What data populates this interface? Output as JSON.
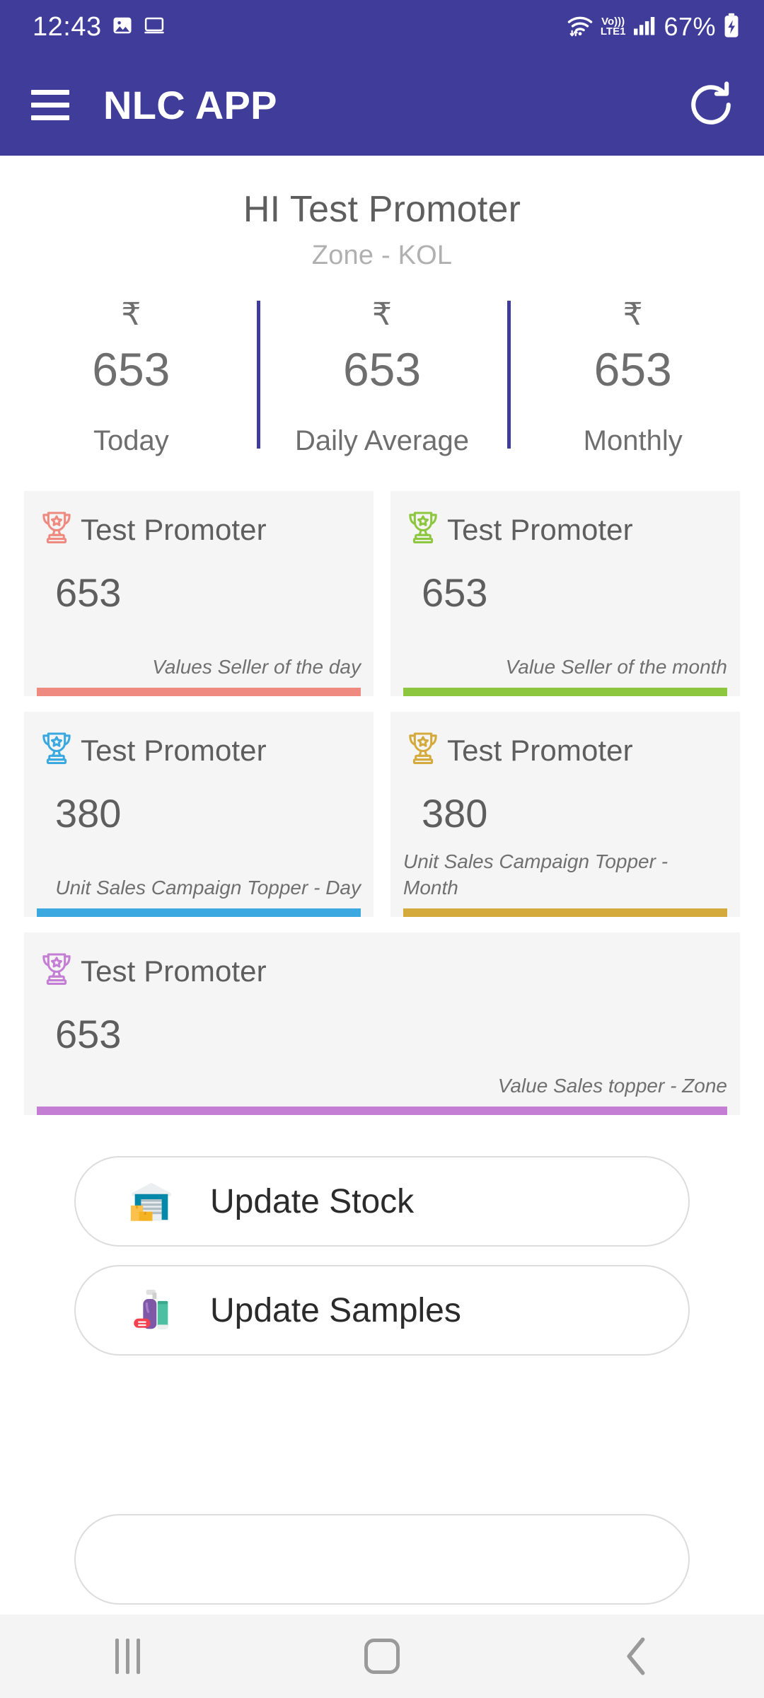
{
  "status_bar": {
    "clock": "12:43",
    "battery_percent": "67%",
    "network_label_top": "Vo)))",
    "network_label_bottom": "LTE1",
    "icons": [
      "photo-icon",
      "screen-mirror-icon",
      "wifi-icon",
      "volte-icon",
      "signal-icon",
      "battery-charging-icon"
    ]
  },
  "app_bar": {
    "title": "NLC APP",
    "menu_icon": "hamburger-menu-icon",
    "refresh_icon": "refresh-icon"
  },
  "header": {
    "greeting": "HI Test Promoter",
    "zone": "Zone - KOL"
  },
  "stats": [
    {
      "currency": "₹",
      "value": "653",
      "label": "Today"
    },
    {
      "currency": "₹",
      "value": "653",
      "label": "Daily Average"
    },
    {
      "currency": "₹",
      "value": "653",
      "label": "Monthly"
    }
  ],
  "awards": [
    {
      "name": "Test Promoter",
      "value": "653",
      "caption": "Values Seller of the day",
      "color": "#ef8a80",
      "icon": "trophy-icon",
      "layout": "half"
    },
    {
      "name": "Test Promoter",
      "value": "653",
      "caption": "Value Seller of the month",
      "color": "#8dc63f",
      "icon": "trophy-icon",
      "layout": "half"
    },
    {
      "name": "Test Promoter",
      "value": "380",
      "caption": "Unit Sales Campaign Topper - Day",
      "color": "#3ba9e0",
      "icon": "trophy-icon",
      "layout": "half"
    },
    {
      "name": "Test Promoter",
      "value": "380",
      "caption": "Unit Sales Campaign Topper - Month",
      "color": "#d4aa3c",
      "icon": "trophy-icon",
      "layout": "half"
    },
    {
      "name": "Test Promoter",
      "value": "653",
      "caption": "Value Sales topper - Zone",
      "color": "#c47fd4",
      "icon": "trophy-icon",
      "layout": "full"
    }
  ],
  "actions": [
    {
      "label": "Update Stock",
      "icon": "warehouse-icon"
    },
    {
      "label": "Update Samples",
      "icon": "toiletries-icon"
    }
  ],
  "nav_bar": {
    "recents_icon": "recents-icon",
    "home_icon": "home-icon",
    "back_icon": "back-icon"
  },
  "colors": {
    "primary": "#3f3d99",
    "card_bg": "#f5f5f5",
    "text_muted": "#6e6e6e"
  }
}
